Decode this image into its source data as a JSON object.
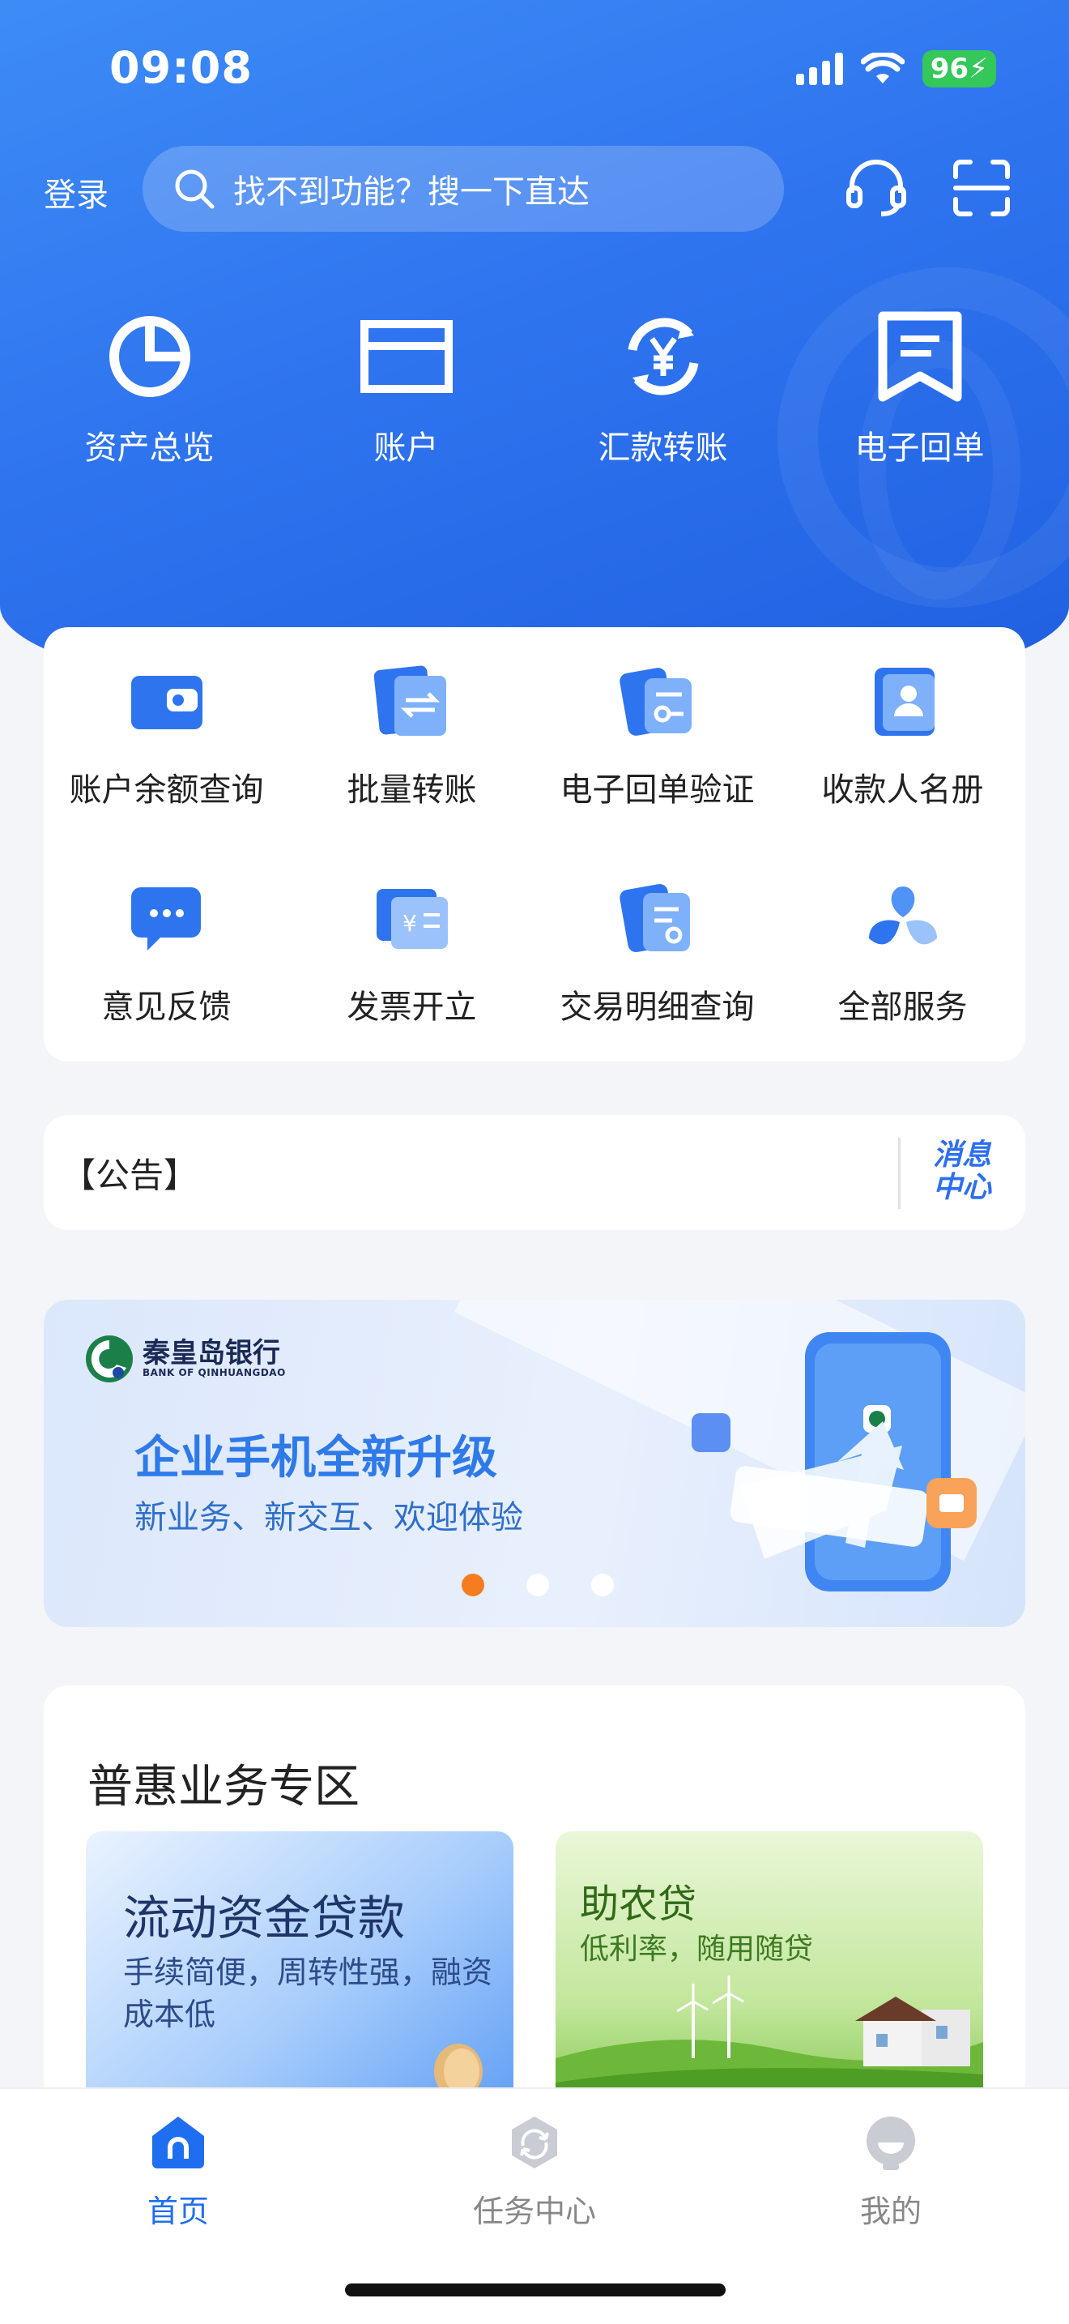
{
  "status_bar": {
    "time": "09:08",
    "battery": "96"
  },
  "header": {
    "login": "登录",
    "search_placeholder": "找不到功能？搜一下直达",
    "icons": [
      "headset-icon",
      "scan-icon"
    ]
  },
  "top_nav": [
    {
      "label": "资产总览",
      "icon": "pie-chart-icon"
    },
    {
      "label": "账户",
      "icon": "card-icon"
    },
    {
      "label": "汇款转账",
      "icon": "yuan-refresh-icon"
    },
    {
      "label": "电子回单",
      "icon": "receipt-icon"
    }
  ],
  "services": [
    {
      "label": "账户余额查询",
      "icon": "wallet-icon"
    },
    {
      "label": "批量转账",
      "icon": "batch-transfer-icon"
    },
    {
      "label": "电子回单验证",
      "icon": "receipt-verify-icon"
    },
    {
      "label": "收款人名册",
      "icon": "payee-book-icon"
    },
    {
      "label": "意见反馈",
      "icon": "feedback-icon"
    },
    {
      "label": "发票开立",
      "icon": "invoice-icon"
    },
    {
      "label": "交易明细查询",
      "icon": "transaction-search-icon"
    },
    {
      "label": "全部服务",
      "icon": "all-services-icon"
    }
  ],
  "notice": {
    "label": "【公告】",
    "message_center": "消息中心"
  },
  "banner": {
    "bank_name": "秦皇岛银行",
    "bank_name_en": "BANK OF QINHUANGDAO",
    "title": "企业手机全新升级",
    "subtitle": "新业务、新交互、欢迎体验",
    "active_slide": 1,
    "slide_count": 3
  },
  "puhui": {
    "title": "普惠业务专区",
    "cards": [
      {
        "title": "流动资金贷款",
        "subtitle": "手续简便，周转性强，融资成本低"
      },
      {
        "title": "助农贷",
        "subtitle": "低利率，随用随贷"
      }
    ]
  },
  "tabbar": [
    {
      "label": "首页",
      "icon": "home-icon",
      "active": true
    },
    {
      "label": "任务中心",
      "icon": "task-center-icon",
      "active": false
    },
    {
      "label": "我的",
      "icon": "profile-icon",
      "active": false
    }
  ]
}
